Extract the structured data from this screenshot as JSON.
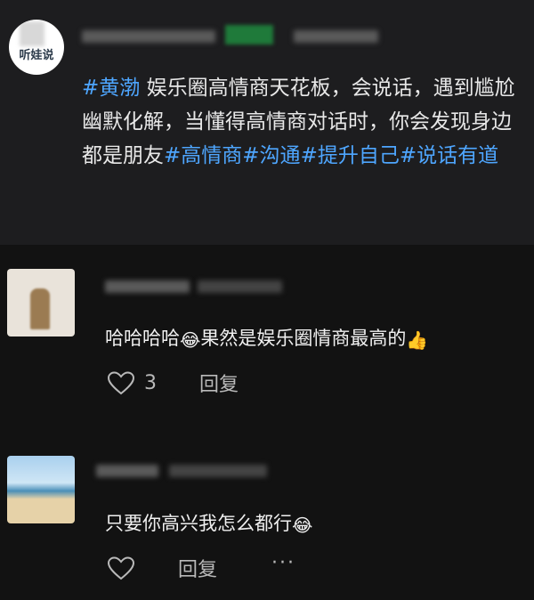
{
  "post": {
    "avatar_text": "听娃说",
    "text_parts": [
      {
        "text": "#黄渤",
        "type": "tag"
      },
      {
        "text": " 娱乐圈高情商天花板，会说话，遇到尴尬幽默化解，当懂得高情商对话时，你会发现身边都是朋友",
        "type": "text"
      },
      {
        "text": "#高情商",
        "type": "tag"
      },
      {
        "text": "#沟通",
        "type": "tag"
      },
      {
        "text": "#提升自己",
        "type": "tag"
      },
      {
        "text": "#说话有道",
        "type": "tag"
      }
    ]
  },
  "comments": [
    {
      "text_before": "哈哈哈哈",
      "emoji1": "😂",
      "text_after": "果然是娱乐圈情商最高的",
      "emoji2": "👍",
      "like_count": "3",
      "reply_label": "回复"
    },
    {
      "text_before": "只要你高兴我怎么都行",
      "emoji1": "😂",
      "reply_label": "回复",
      "more_label": "···"
    }
  ],
  "colors": {
    "background": "#121212",
    "post_background": "#1d1d1f",
    "tag": "#4ea6ff",
    "text": "#e8e8e8",
    "secondary": "#b9b9b9"
  }
}
